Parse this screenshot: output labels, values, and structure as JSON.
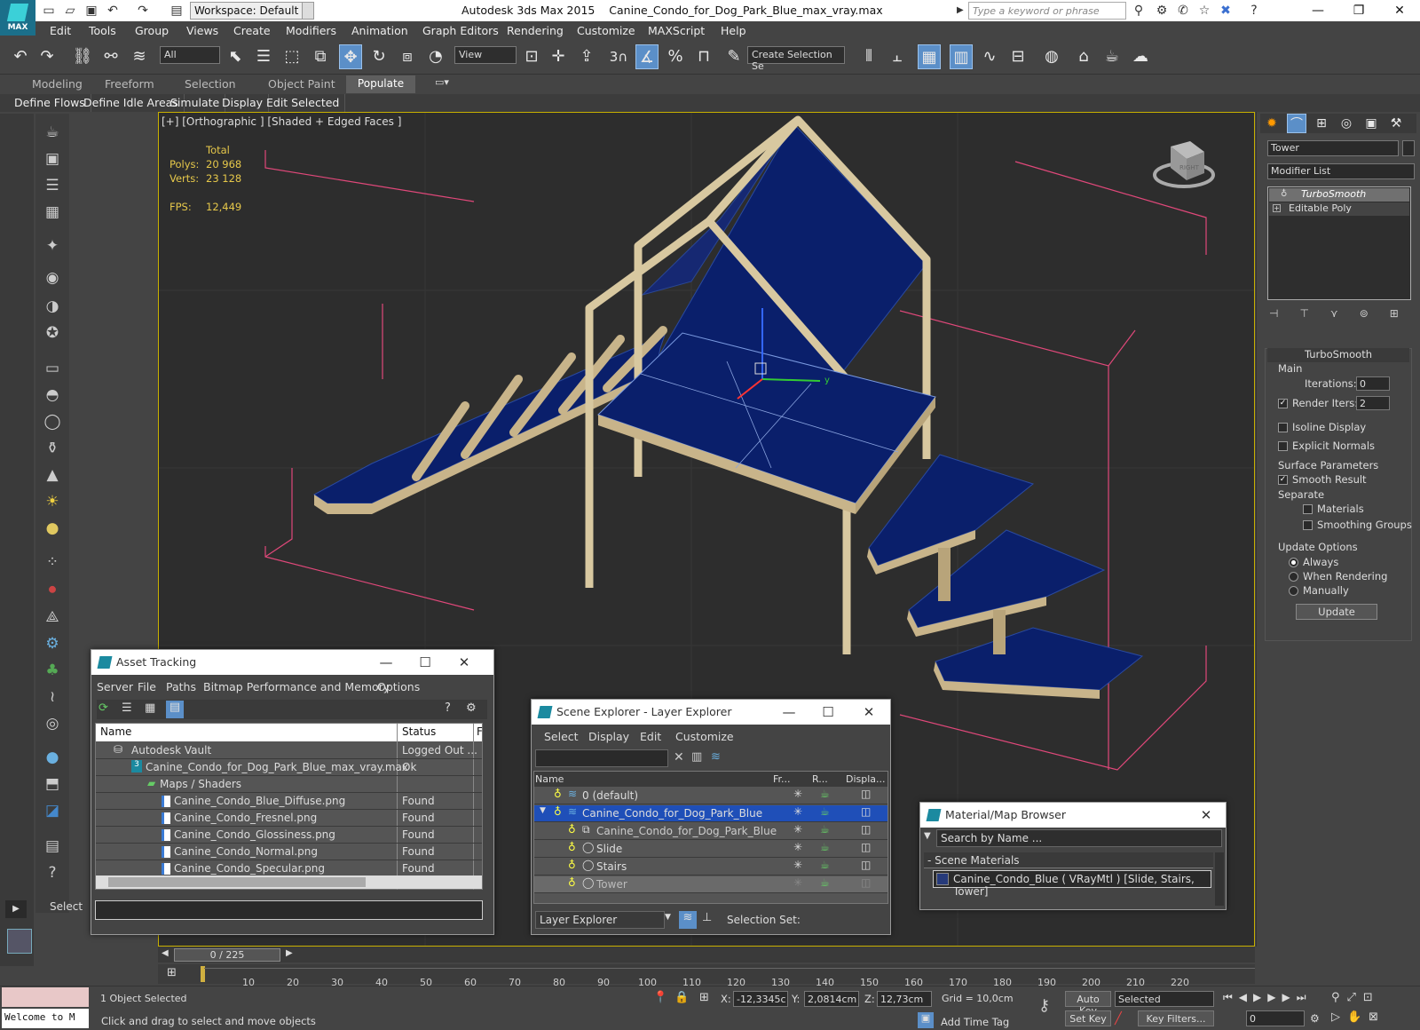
{
  "titlebar": {
    "workspace": "Workspace: Default",
    "app": "Autodesk 3ds Max  2015",
    "file": "Canine_Condo_for_Dog_Park_Blue_max_vray.max",
    "search_placeholder": "Type a keyword or phrase",
    "logo": "MAX"
  },
  "menu": [
    "Edit",
    "Tools",
    "Group",
    "Views",
    "Create",
    "Modifiers",
    "Animation",
    "Graph Editors",
    "Rendering",
    "Customize",
    "MAXScript",
    "Help"
  ],
  "toolbar": {
    "filter": "All",
    "refcoord": "View",
    "selset": "Create Selection Se",
    "snap_label": "3"
  },
  "ribbon": {
    "tabs": [
      "Modeling",
      "Freeform",
      "Selection",
      "Object Paint"
    ],
    "active": "Populate",
    "subtabs": [
      "Define Flows",
      "Define Idle Areas",
      "Simulate",
      "Display",
      "Edit Selected"
    ]
  },
  "viewport": {
    "label": "[+] [Orthographic ] [Shaded + Edged Faces ]",
    "stats_header": "Total",
    "polys_label": "Polys:",
    "polys": "20 968",
    "verts_label": "Verts:",
    "verts": "23 128",
    "fps_label": "FPS:",
    "fps": "12,449",
    "axis_y": "y",
    "viewcube": "RIGHT"
  },
  "command_panel": {
    "object_name": "Tower",
    "modifier_list": "Modifier List",
    "stack": [
      "TurboSmooth",
      "Editable Poly"
    ],
    "rollout_title": "TurboSmooth",
    "main": "Main",
    "iterations_label": "Iterations:",
    "iterations": "0",
    "render_iters_label": "Render Iters:",
    "render_iters": "2",
    "isoline": "Isoline Display",
    "explicit": "Explicit Normals",
    "surface_params": "Surface Parameters",
    "smooth_result": "Smooth Result",
    "separate": "Separate",
    "materials": "Materials",
    "smoothing_groups": "Smoothing Groups",
    "update_options": "Update Options",
    "always": "Always",
    "when_rendering": "When Rendering",
    "manually": "Manually",
    "update_btn": "Update"
  },
  "asset_tracking": {
    "title": "Asset Tracking",
    "menu": [
      "Server",
      "File",
      "Paths",
      "Bitmap Performance and Memory",
      "Options"
    ],
    "col_name": "Name",
    "col_status": "Status",
    "col_extra": "F",
    "rows": [
      {
        "name": "Autodesk Vault",
        "status": "Logged Out ..."
      },
      {
        "name": "Canine_Condo_for_Dog_Park_Blue_max_vray.max",
        "status": "Ok"
      },
      {
        "name": "Maps / Shaders",
        "status": ""
      },
      {
        "name": "Canine_Condo_Blue_Diffuse.png",
        "status": "Found"
      },
      {
        "name": "Canine_Condo_Fresnel.png",
        "status": "Found"
      },
      {
        "name": "Canine_Condo_Glossiness.png",
        "status": "Found"
      },
      {
        "name": "Canine_Condo_Normal.png",
        "status": "Found"
      },
      {
        "name": "Canine_Condo_Specular.png",
        "status": "Found"
      }
    ]
  },
  "scene_explorer": {
    "title": "Scene Explorer - Layer Explorer",
    "menu": [
      "Select",
      "Display",
      "Edit",
      "Customize"
    ],
    "col_name": "Name",
    "col_fr": "Fr...",
    "col_r": "R...",
    "col_disp": "Displa...",
    "rows": [
      {
        "name": "0 (default)"
      },
      {
        "name": "Canine_Condo_for_Dog_Park_Blue"
      },
      {
        "name": "Canine_Condo_for_Dog_Park_Blue"
      },
      {
        "name": "Slide"
      },
      {
        "name": "Stairs"
      },
      {
        "name": "Tower"
      }
    ],
    "footer_mode": "Layer Explorer",
    "selection_set": "Selection Set:"
  },
  "material_browser": {
    "title": "Material/Map Browser",
    "search": "Search by Name ...",
    "group": "- Scene Materials",
    "item": "Canine_Condo_Blue  ( VRayMtl ) [Slide, Stairs, Tower]"
  },
  "timeline": {
    "frame": "0 / 225",
    "ticks": [
      "10",
      "20",
      "30",
      "40",
      "50",
      "60",
      "70",
      "80",
      "90",
      "100",
      "110",
      "120",
      "130",
      "140",
      "150",
      "160",
      "170",
      "180",
      "190",
      "200",
      "210",
      "220"
    ]
  },
  "status": {
    "selected": "1 Object Selected",
    "hint": "Click and drag to select and move objects",
    "welcome": "Welcome to M",
    "select_label": "Select",
    "x_label": "X:",
    "x": "-12,3345c",
    "y_label": "Y:",
    "y": "2,0814cm",
    "z_label": "Z:",
    "z": "12,73cm",
    "grid": "Grid = 10,0cm",
    "add_time_tag": "Add Time Tag",
    "auto_key": "Auto Key",
    "set_key": "Set Key",
    "key_mode": "Selected",
    "key_filters": "Key Filters...",
    "frame_field": "0"
  },
  "colors": {
    "accent": "#5b8fc8",
    "viewport_border": "#c8b000",
    "stats": "#e6c84a",
    "selection": "#1f4fb8",
    "model_blue": "#0a1f6b",
    "model_wood": "#c8b48a",
    "bbox_pink": "#e0487a"
  }
}
